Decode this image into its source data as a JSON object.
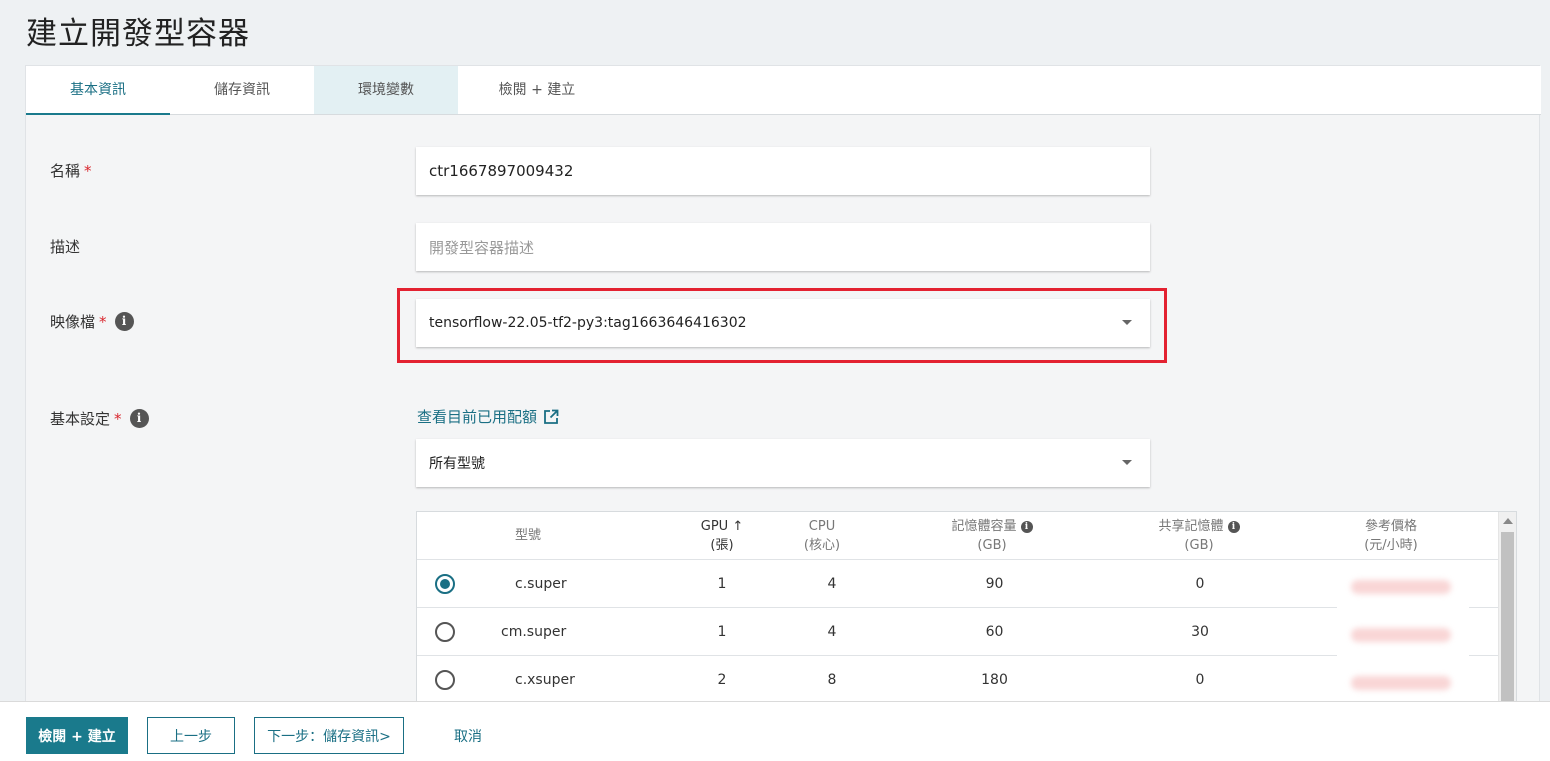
{
  "page": {
    "title": "建立開發型容器"
  },
  "tabs": [
    {
      "label": "基本資訊"
    },
    {
      "label": "儲存資訊"
    },
    {
      "label": "環境變數"
    },
    {
      "label": "檢閱 + 建立"
    }
  ],
  "form": {
    "name": {
      "label": "名稱",
      "required": "*",
      "value": "ctr1667897009432"
    },
    "description": {
      "label": "描述",
      "placeholder": "開發型容器描述"
    },
    "image": {
      "label": "映像檔",
      "required": "*",
      "info": "i",
      "value": "tensorflow-22.05-tf2-py3:tag1663646416302"
    },
    "basic_settings": {
      "label": "基本設定",
      "required": "*",
      "info": "i",
      "quota_link": "查看目前已用配額",
      "filter_value": "所有型號"
    }
  },
  "table": {
    "headers": {
      "model": "型號",
      "gpu": "GPU",
      "gpu_sort": "↑",
      "gpu_unit": "(張)",
      "cpu": "CPU",
      "cpu_unit": "(核心)",
      "memory": "記憶體容量",
      "memory_unit": "(GB)",
      "shared_memory": "共享記憶體",
      "shared_memory_unit": "(GB)",
      "price": "參考價格",
      "price_unit": "(元/小時)"
    },
    "rows": [
      {
        "model": "c.super",
        "gpu": "1",
        "cpu": "4",
        "memory": "90",
        "shared": "0",
        "selected": true
      },
      {
        "model": "cm.super",
        "gpu": "1",
        "cpu": "4",
        "memory": "60",
        "shared": "30",
        "selected": false
      },
      {
        "model": "c.xsuper",
        "gpu": "2",
        "cpu": "8",
        "memory": "180",
        "shared": "0",
        "selected": false
      }
    ]
  },
  "footer": {
    "review_create": "檢閱 + 建立",
    "prev": "上一步",
    "next": "下一步：儲存資訊>",
    "cancel": "取消"
  },
  "colors": {
    "accent": "#1a7a8c",
    "required": "#d9272e",
    "highlight": "#e32231"
  }
}
